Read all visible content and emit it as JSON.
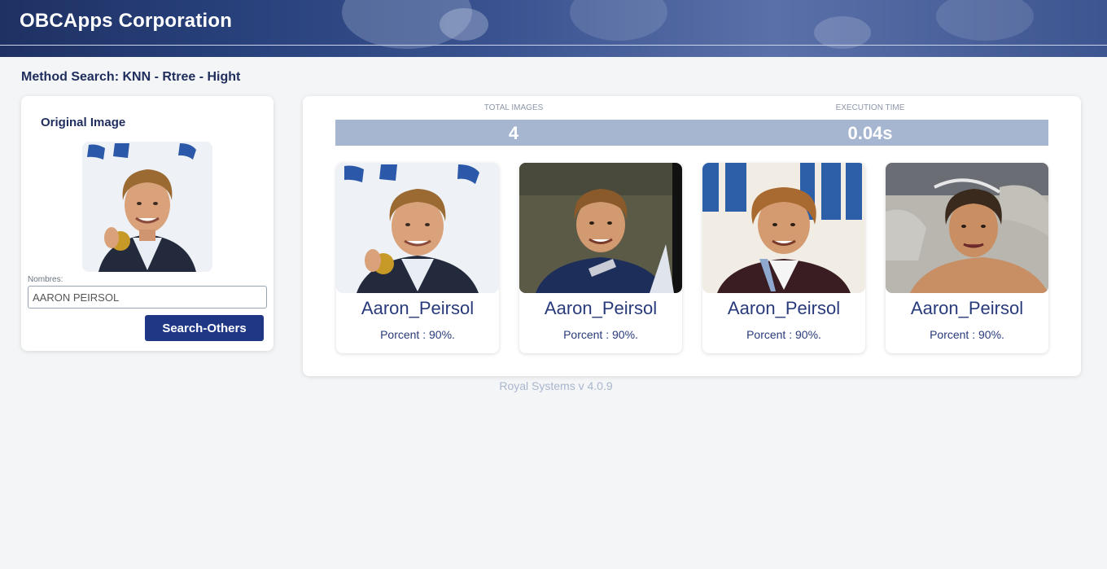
{
  "header": {
    "brand": "OBCApps Corporation"
  },
  "method": "Method Search: KNN - Rtree - Hight",
  "original": {
    "title": "Original Image",
    "field_label": "Nombres:",
    "field_value": "AARON PEIRSOL",
    "button_label": "Search-Others"
  },
  "stats": {
    "total_label": "TOTAL IMAGES",
    "total_value": "4",
    "time_label": "EXECUTION TIME",
    "time_value": "0.04s"
  },
  "results": [
    {
      "name": "Aaron_Peirsol",
      "percent": "Porcent : 90%."
    },
    {
      "name": "Aaron_Peirsol",
      "percent": "Porcent : 90%."
    },
    {
      "name": "Aaron_Peirsol",
      "percent": "Porcent : 90%."
    },
    {
      "name": "Aaron_Peirsol",
      "percent": "Porcent : 90%."
    }
  ],
  "footer": "Royal Systems v 4.0.9"
}
